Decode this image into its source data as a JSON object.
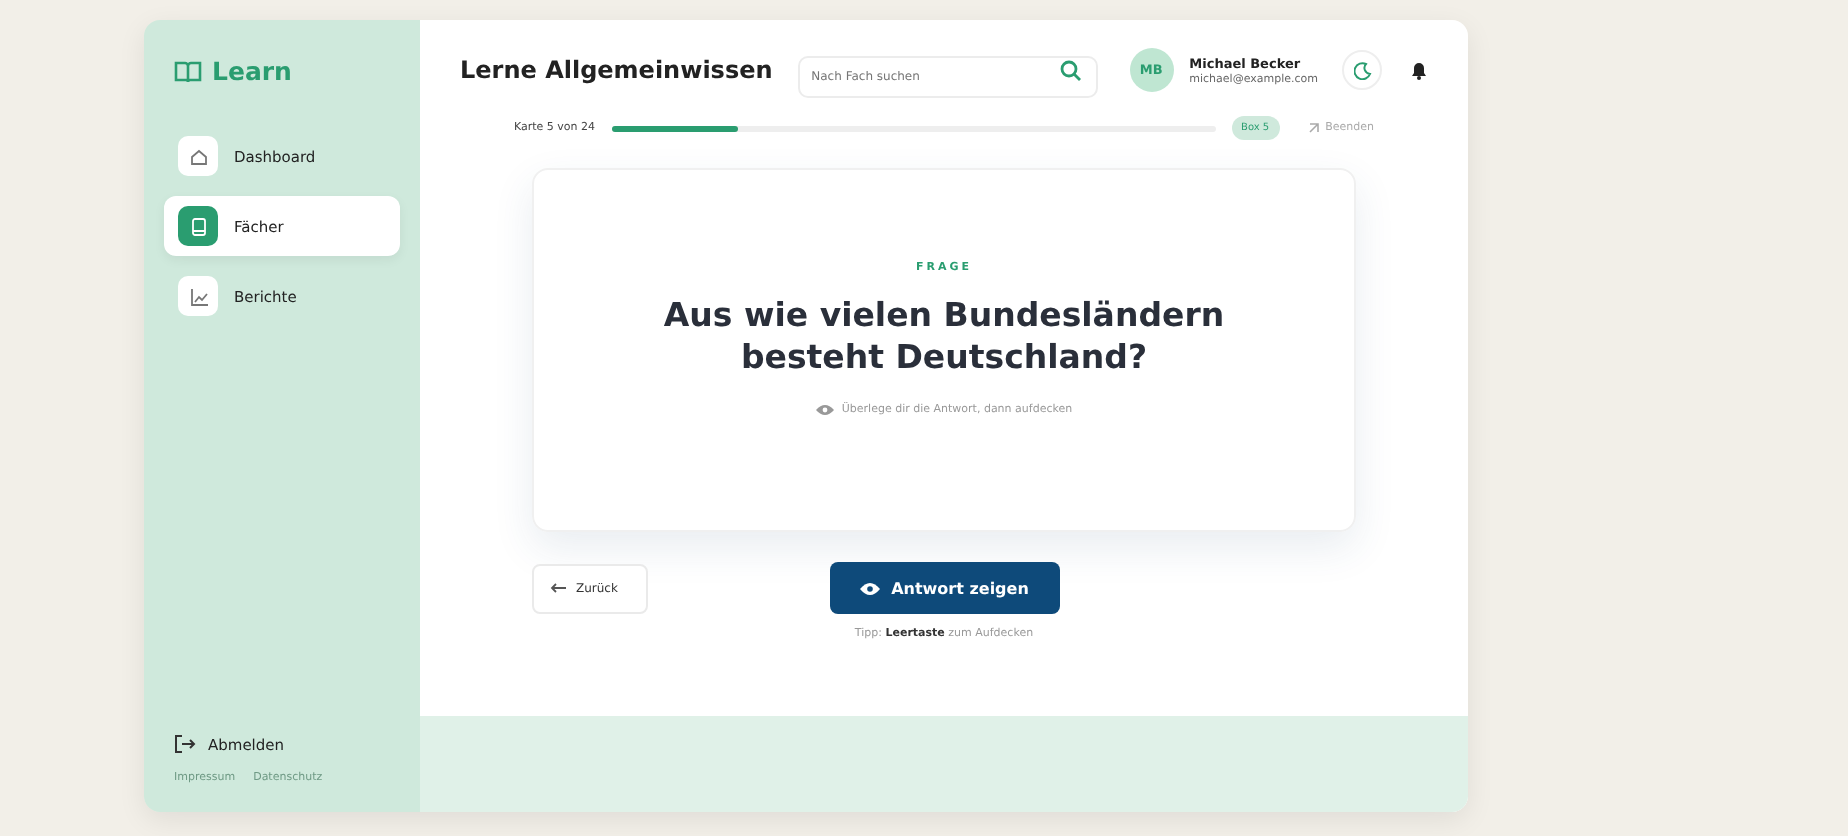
{
  "brand": "Learn",
  "nav": [
    {
      "label": "Dashboard",
      "selected": false
    },
    {
      "label": "Fächer",
      "selected": true
    },
    {
      "label": "Berichte",
      "selected": false
    }
  ],
  "logout": "Abmelden",
  "footer_links": [
    "Impressum",
    "Datenschutz"
  ],
  "title": "Lerne Allgemeinwissen",
  "search": {
    "placeholder": "Nach Fach suchen"
  },
  "user": {
    "initials": "MB",
    "name": "Michael Becker",
    "email": "michael@example.com"
  },
  "progress": {
    "label": "Karte 5 von 24",
    "level": 0.21,
    "badge": "Box 5",
    "end": "Beenden"
  },
  "card": {
    "eyebrow": "FRAGE",
    "question": "Aus wie vielen Bundesländern besteht Deutschland?",
    "hint": "Überlege dir die Antwort, dann aufdecken"
  },
  "back": "Zurück",
  "reveal": "Antwort zeigen",
  "tip": "Tipp: **Leertaste** zum Aufdecken"
}
